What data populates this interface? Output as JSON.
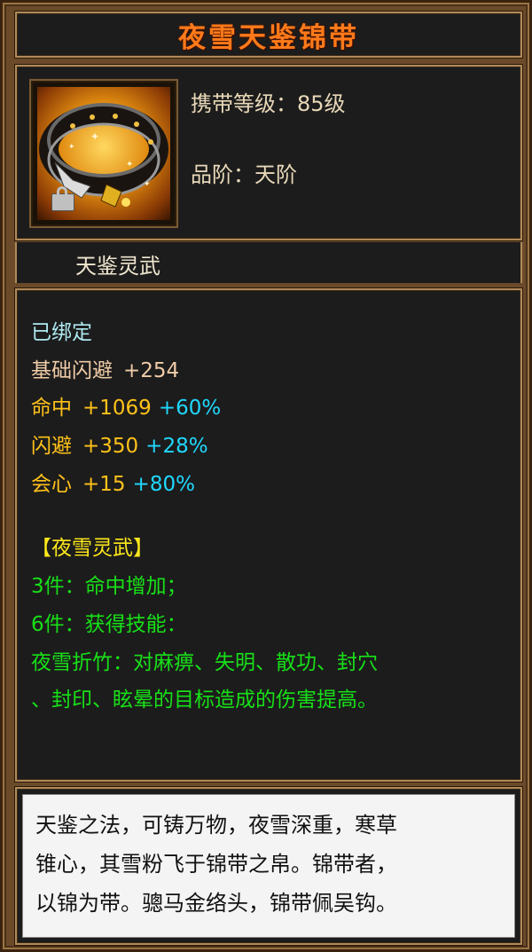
{
  "item": {
    "name": "夜雪天鉴锦带",
    "carry_level_label": "携带等级：",
    "carry_level_value": "85级",
    "grade_label": "品阶：",
    "grade_value": "天阶",
    "type": "天鉴灵武",
    "icon": "belt-icon",
    "lock_icon": "lock-icon"
  },
  "stats": {
    "bound": "已绑定",
    "base": {
      "label": "基础闪避",
      "value": "+254"
    },
    "lines": [
      {
        "label": "命中",
        "value": "+1069",
        "bonus": "+60%"
      },
      {
        "label": "闪避",
        "value": "+350",
        "bonus": "+28%"
      },
      {
        "label": "会心",
        "value": "+15",
        "bonus": "+80%"
      }
    ]
  },
  "set": {
    "title": "【夜雪灵武】",
    "three_piece": "3件：命中增加；",
    "six_piece": "6件：获得技能：",
    "skill_line1": "夜雪折竹：对麻痹、失明、散功、封穴",
    "skill_line2": "、封印、眩晕的目标造成的伤害提高。"
  },
  "description": {
    "line1": "天鉴之法，可铸万物，夜雪深重，寒草",
    "line2": "锥心，其雪粉飞于锦带之帛。锦带者，",
    "line3": "以锦为带。骢马金络头，锦带佩吴钩。"
  },
  "colors": {
    "title": "#ff7a1a",
    "bound": "#aee8f0",
    "base_stat": "#f0cca8",
    "stat": "#ffc21a",
    "bonus": "#20d8ff",
    "set_title": "#ffe81a",
    "set_text": "#18e018"
  }
}
